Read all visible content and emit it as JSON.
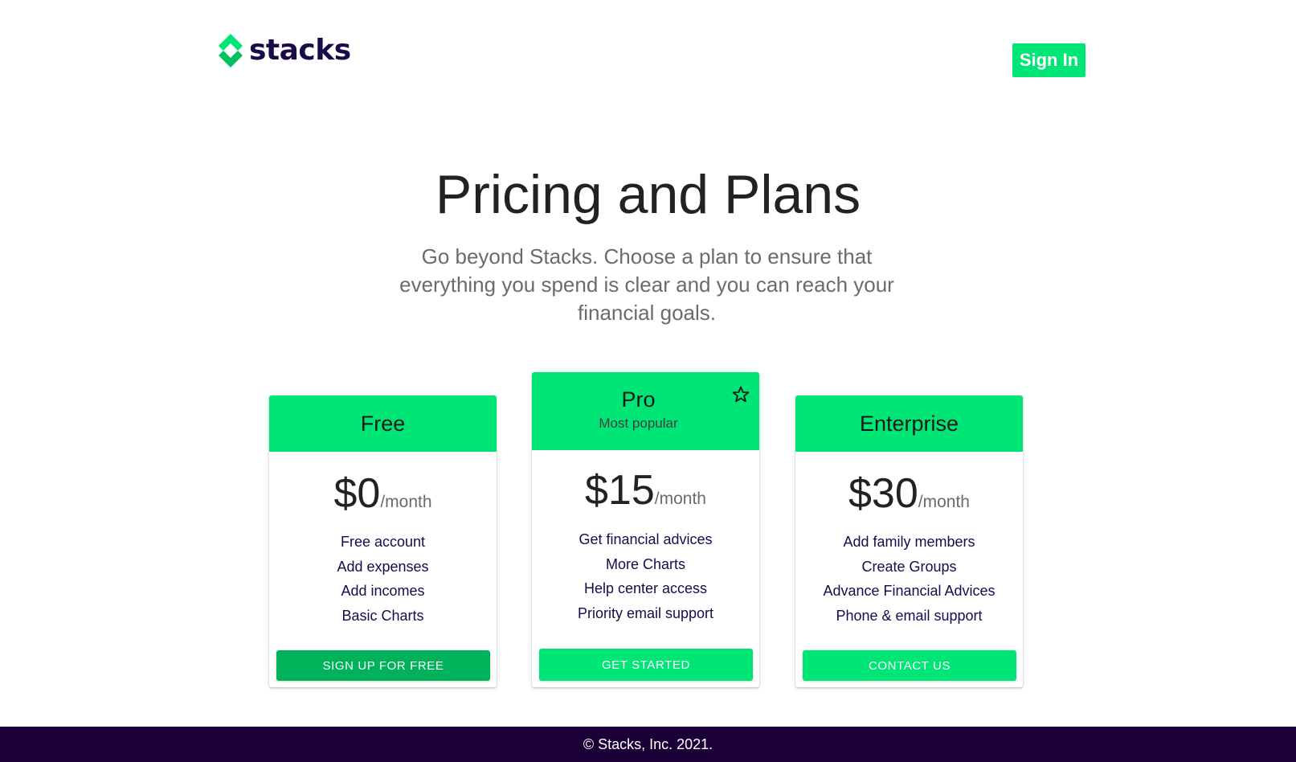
{
  "brand": {
    "name": "stacks",
    "logo_icon": "stacks-logo-icon",
    "accent_color": "#00e676",
    "dark_color": "#1b0a4a"
  },
  "header": {
    "sign_in_label": "Sign In"
  },
  "hero": {
    "title": "Pricing and Plans",
    "subtitle": "Go beyond Stacks. Choose a plan to ensure that everything you spend is clear and you can reach your financial goals."
  },
  "plans": [
    {
      "name": "Free",
      "price": "$0",
      "period": "/month",
      "features": [
        "Free account",
        "Add expenses",
        "Add incomes",
        "Basic Charts"
      ],
      "cta_label": "Sign up for free",
      "cta_color": "#00b259"
    },
    {
      "name": "Pro",
      "tag": "Most popular",
      "icon": "star-icon",
      "price": "$15",
      "period": "/month",
      "features": [
        "Get financial advices",
        "More Charts",
        "Help center access",
        "Priority email support"
      ],
      "cta_label": "Get started",
      "cta_color": "#00e676"
    },
    {
      "name": "Enterprise",
      "price": "$30",
      "period": "/month",
      "features": [
        "Add family members",
        "Create Groups",
        "Advance Financial Advices",
        "Phone & email support"
      ],
      "cta_label": "Contact us",
      "cta_color": "#00e676"
    }
  ],
  "footer": {
    "copyright": "© Stacks, Inc. 2021."
  }
}
